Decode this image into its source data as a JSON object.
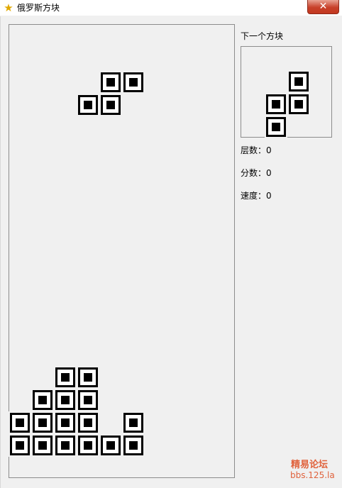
{
  "window": {
    "title": "俄罗斯方块",
    "close_label": "✕"
  },
  "panel": {
    "next_label": "下一个方块",
    "level_label": "层数：",
    "level_value": "0",
    "score_label": "分数：",
    "score_value": "0",
    "speed_label": "速度：",
    "speed_value": "0"
  },
  "board": {
    "grid": {
      "cols": 10,
      "rows": 20
    },
    "falling_piece": {
      "type": "S",
      "cells": [
        [
          4,
          3
        ],
        [
          5,
          3
        ],
        [
          3,
          4
        ],
        [
          4,
          4
        ]
      ]
    },
    "stack": [
      [
        2,
        16
      ],
      [
        3,
        16
      ],
      [
        1,
        17
      ],
      [
        2,
        17
      ],
      [
        3,
        17
      ],
      [
        0,
        18
      ],
      [
        1,
        18
      ],
      [
        2,
        18
      ],
      [
        3,
        18
      ],
      [
        5,
        18
      ],
      [
        0,
        19
      ],
      [
        1,
        19
      ],
      [
        2,
        19
      ],
      [
        3,
        19
      ],
      [
        4,
        19
      ],
      [
        5,
        19
      ]
    ]
  },
  "next_piece": {
    "type": "S",
    "cells": [
      [
        2,
        1
      ],
      [
        1,
        2
      ],
      [
        2,
        2
      ],
      [
        1,
        3
      ]
    ]
  },
  "watermark": {
    "line1": "精易论坛",
    "line2": "bbs.125.la"
  }
}
